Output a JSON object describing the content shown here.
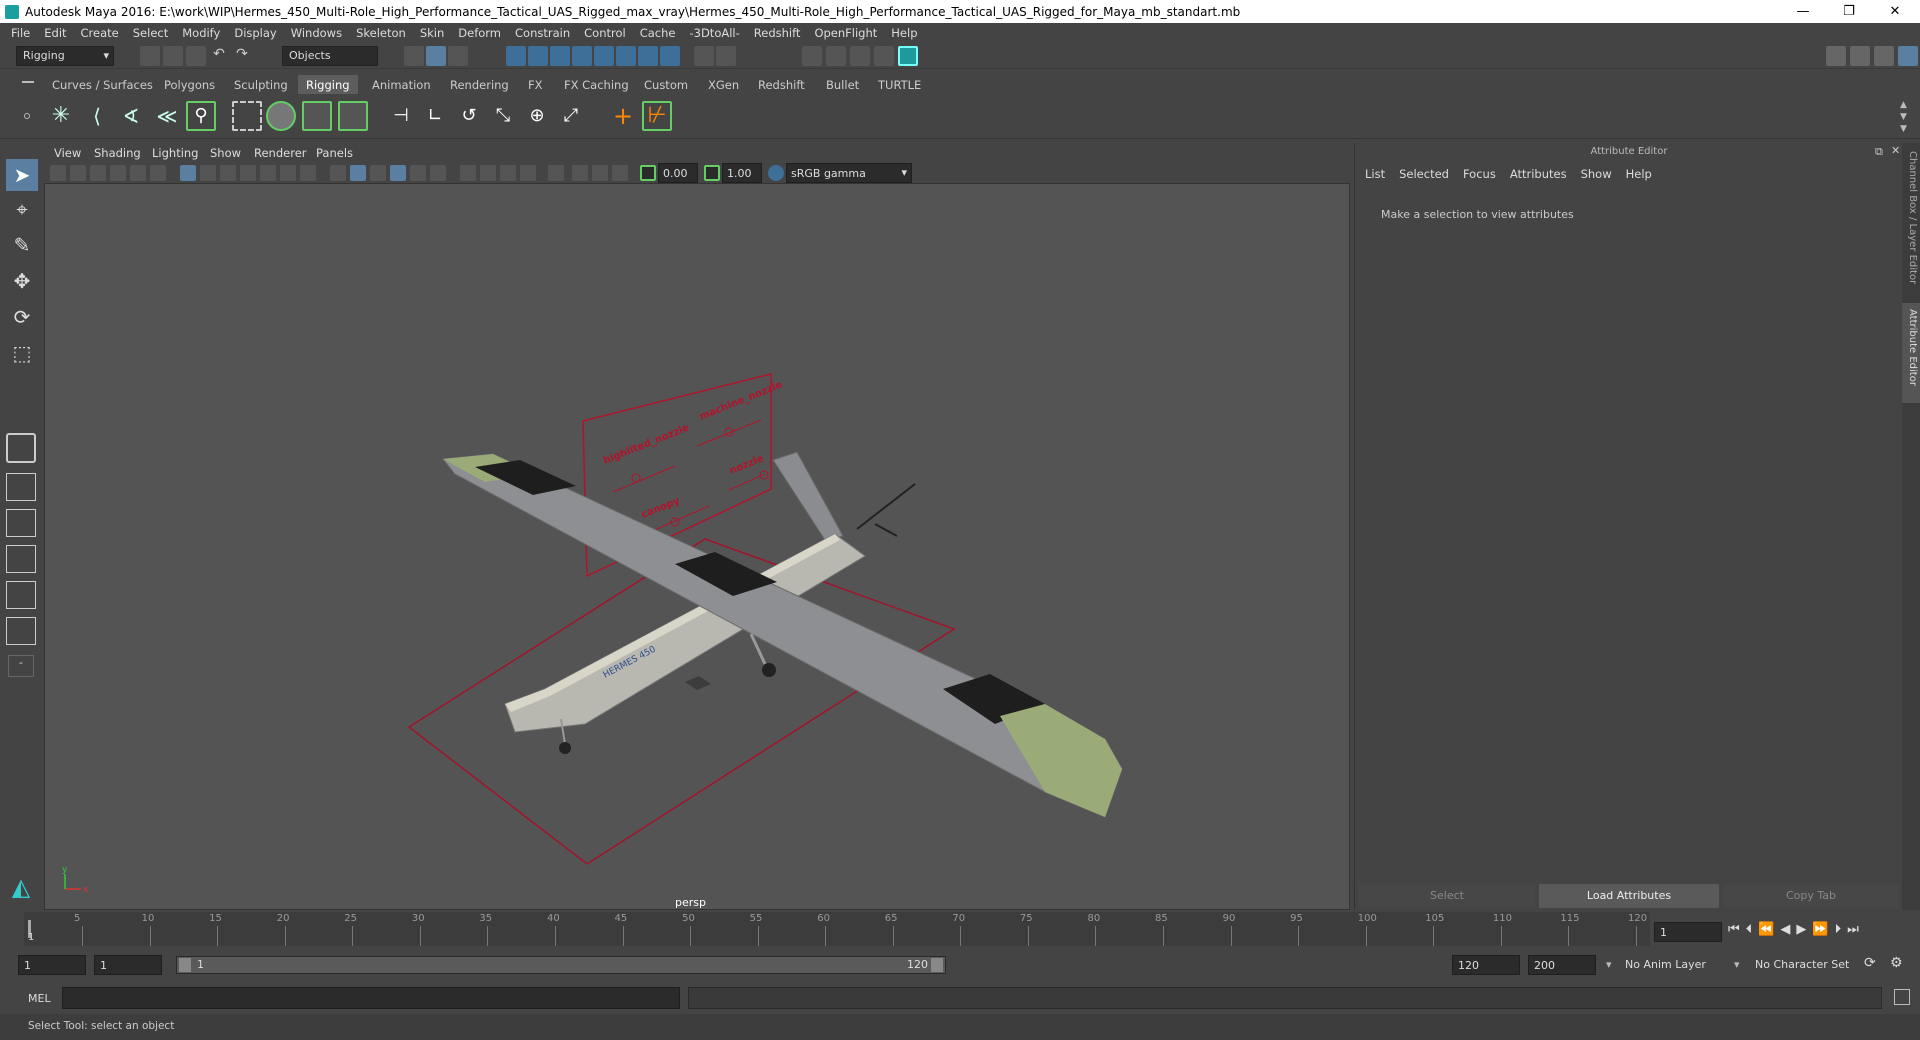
{
  "window": {
    "title": "Autodesk Maya 2016: E:\\work\\WIP\\Hermes_450_Multi-Role_High_Performance_Tactical_UAS_Rigged_max_vray\\Hermes_450_Multi-Role_High_Performance_Tactical_UAS_Rigged_for_Maya_mb_standart.mb",
    "minimize": "—",
    "restore": "❐",
    "close": "✕"
  },
  "menubar": [
    "File",
    "Edit",
    "Create",
    "Select",
    "Modify",
    "Display",
    "Windows",
    "Skeleton",
    "Skin",
    "Deform",
    "Constrain",
    "Control",
    "Cache",
    "-3DtoAll-",
    "Redshift",
    "OpenFlight",
    "Help"
  ],
  "statusline": {
    "menuset": "Rigging",
    "selection_mode": "Objects"
  },
  "shelf_tabs": [
    "Curves / Surfaces",
    "Polygons",
    "Sculpting",
    "Rigging",
    "Animation",
    "Rendering",
    "FX",
    "FX Caching",
    "Custom",
    "XGen",
    "Redshift",
    "Bullet",
    "TURTLE"
  ],
  "active_shelf_tab": "Rigging",
  "viewport": {
    "menu": [
      "View",
      "Shading",
      "Lighting",
      "Show",
      "Renderer",
      "Panels"
    ],
    "exposure": "0.00",
    "gamma": "1.00",
    "color_space": "sRGB gamma",
    "camera_label": "persp",
    "axis_x": "x",
    "axis_y": "y",
    "control_labels": [
      "highlited_nozzle",
      "machine_nozzle",
      "canopy",
      "nozzle"
    ]
  },
  "attribute_editor": {
    "title": "Attribute Editor",
    "menu": [
      "List",
      "Selected",
      "Focus",
      "Attributes",
      "Show",
      "Help"
    ],
    "message": "Make a selection to view attributes",
    "buttons": [
      "Select",
      "Load Attributes",
      "Copy Tab"
    ]
  },
  "side_tabs": [
    "Channel Box / Layer Editor",
    "Attribute Editor"
  ],
  "timeslider": {
    "ticks": [
      "5",
      "10",
      "15",
      "20",
      "25",
      "30",
      "35",
      "40",
      "45",
      "50",
      "55",
      "60",
      "65",
      "70",
      "75",
      "80",
      "85",
      "90",
      "95",
      "100",
      "105",
      "110",
      "115",
      "120"
    ],
    "current_marker": "1",
    "current_frame": "1"
  },
  "range": {
    "start": "1",
    "anim_start": "1",
    "slider_start": "1",
    "slider_end": "120",
    "anim_end": "120",
    "end": "200",
    "anim_layer": "No Anim Layer",
    "character_set": "No Character Set"
  },
  "command_line": {
    "label": "MEL"
  },
  "help_line": "Select Tool: select an object"
}
